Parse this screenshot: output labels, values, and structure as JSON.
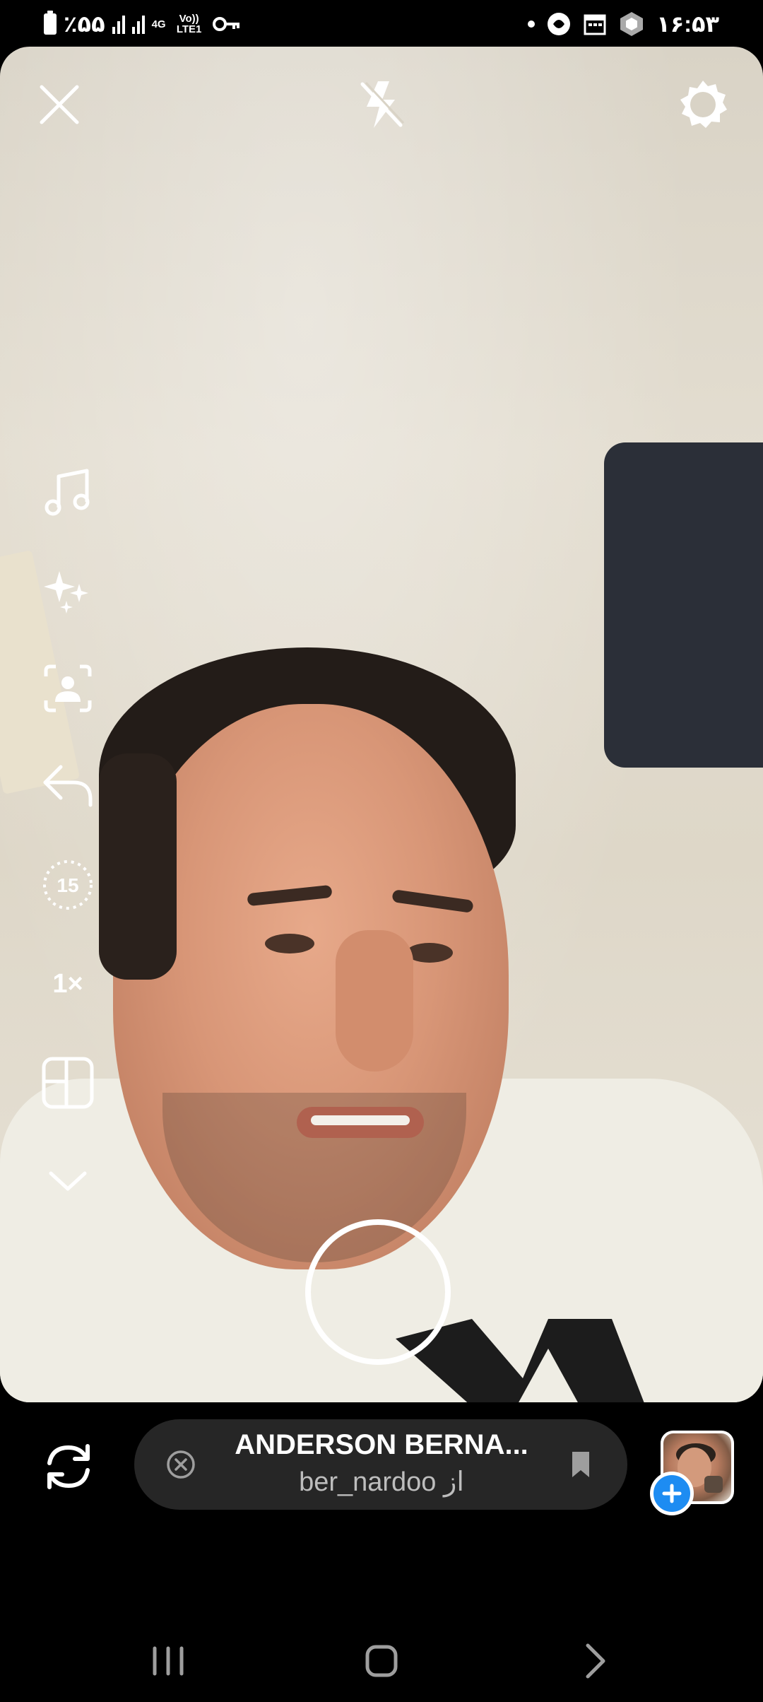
{
  "status_bar": {
    "battery": "٪۵۵",
    "network": "4G",
    "volte": "Vo)) LTE1",
    "time": "۱۶:۵۳"
  },
  "top_controls": {
    "close_icon": "close-icon",
    "flash_icon": "flash-off-icon",
    "settings_icon": "gear-icon"
  },
  "toolbar": {
    "items": [
      {
        "name": "music",
        "icon": "music-note-icon"
      },
      {
        "name": "effects",
        "icon": "sparkles-icon"
      },
      {
        "name": "touch-up",
        "icon": "portrait-frame-icon"
      },
      {
        "name": "undo",
        "icon": "undo-arrow-icon"
      },
      {
        "name": "timer",
        "icon": "timer-icon",
        "label": "15"
      },
      {
        "name": "zoom",
        "label": "1×"
      },
      {
        "name": "layout",
        "icon": "layout-grid-icon"
      },
      {
        "name": "more",
        "icon": "chevron-down-icon"
      }
    ]
  },
  "bottom": {
    "flip_icon": "flip-camera-icon",
    "music_pill": {
      "title": "ANDERSON BERNA...",
      "subtitle": "ber_nardoo از",
      "remove_icon": "remove-circle-icon",
      "save_icon": "bookmark-icon"
    },
    "gallery_icon": "gallery-thumbnail-icon",
    "add_icon": "plus-icon"
  },
  "colors": {
    "accent_blue": "#1d8cf2",
    "pill_bg": "#262626",
    "background": "#000000"
  }
}
